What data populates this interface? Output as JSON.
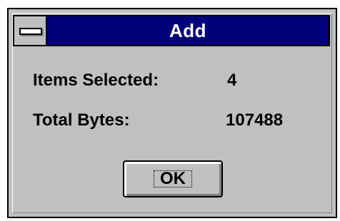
{
  "window": {
    "title": "Add",
    "system_menu_icon": "system-menu-dash-icon"
  },
  "info": {
    "items_selected_label": "Items Selected:",
    "items_selected_value": "4",
    "total_bytes_label": "Total Bytes:",
    "total_bytes_value": "107488"
  },
  "buttons": {
    "ok_label": "OK"
  },
  "colors": {
    "title_bar": "#00007b",
    "dialog_face": "#c0c0c0",
    "title_text": "#ffffff"
  }
}
